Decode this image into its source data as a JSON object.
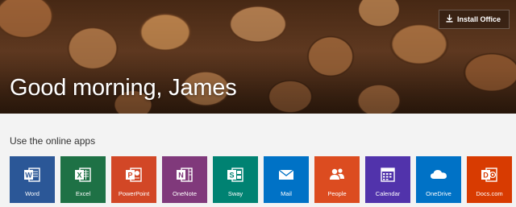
{
  "header": {
    "install_label": "Install Office",
    "greeting": "Good morning, James"
  },
  "apps": {
    "section_title": "Use the online apps",
    "tiles": [
      {
        "label": "Word",
        "color": "#2b5797",
        "icon": "word-icon"
      },
      {
        "label": "Excel",
        "color": "#1e7145",
        "icon": "excel-icon"
      },
      {
        "label": "PowerPoint",
        "color": "#d24726",
        "icon": "powerpoint-icon"
      },
      {
        "label": "OneNote",
        "color": "#80397b",
        "icon": "onenote-icon"
      },
      {
        "label": "Sway",
        "color": "#008272",
        "icon": "sway-icon"
      },
      {
        "label": "Mail",
        "color": "#0072c6",
        "icon": "mail-icon"
      },
      {
        "label": "People",
        "color": "#dc4c20",
        "icon": "people-icon"
      },
      {
        "label": "Calendar",
        "color": "#5133ab",
        "icon": "calendar-icon"
      },
      {
        "label": "OneDrive",
        "color": "#0072c6",
        "icon": "onedrive-icon"
      },
      {
        "label": "Docs.com",
        "color": "#d83b01",
        "icon": "docs-icon"
      }
    ]
  }
}
